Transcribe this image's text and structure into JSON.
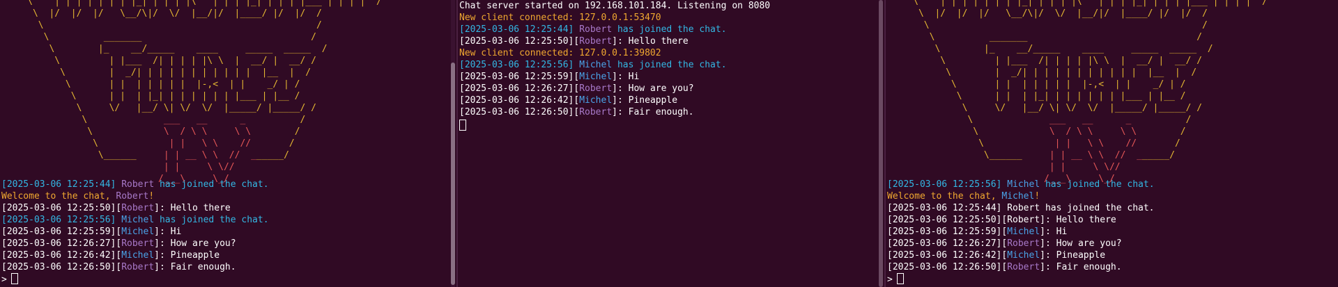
{
  "banner": {
    "lines": [
      "     \\    | | | | | | | |_| | | | |\\   | | | |_| | | | |___ | | | |  /",
      "      \\  |/  |/  |/   \\__/\\|/  \\/  |__/|/  |____/ |/  |/  /",
      "       \\                                                  /",
      "        \\          _______                               /",
      "         \\        |_    __/_____    ____     _____  _____  /",
      "          \\         | |___  /| | | | |\\ \\  |  __/ |  __/ /",
      "           \\        |  _/| | | | | | | | | | |  |__  |  /",
      "            \\       | |  | | | | |  |-,<  | |    _/ | /",
      "             \\      | |  | |_| | | | | | | |___ | |__ /",
      "              \\     \\/   |__/ \\| \\/  \\/  |_____/ |_____/ /",
      "               \\              ___   __      _          /",
      "                \\             \\  / \\ \\     \\ \\        /",
      "                 \\             | |   \\ \\    //       /",
      "                  \\______     | | __ \\ \\  //  ______/",
      "                              | |     \\ \\//",
      "                             /___\\     \\_/"
    ]
  },
  "left": {
    "lines": [
      [
        {
          "t": "[2025-03-06 12:25:44] ",
          "c": "cyan"
        },
        {
          "t": "Robert",
          "c": "purple"
        },
        {
          "t": " has joined the chat.",
          "c": "cyan"
        }
      ],
      [
        {
          "t": "Welcome to the chat, ",
          "c": "yellow"
        },
        {
          "t": "Robert",
          "c": "purple"
        },
        {
          "t": "!",
          "c": "yellow"
        }
      ],
      [
        {
          "t": "[2025-03-06 12:25:50][",
          "c": "white"
        },
        {
          "t": "Robert",
          "c": "purple"
        },
        {
          "t": "]: Hello there",
          "c": "white"
        }
      ],
      [
        {
          "t": "[2025-03-06 12:25:56] ",
          "c": "cyan"
        },
        {
          "t": "Michel",
          "c": "blue"
        },
        {
          "t": " has joined the chat.",
          "c": "cyan"
        }
      ],
      [
        {
          "t": "[2025-03-06 12:25:59][",
          "c": "white"
        },
        {
          "t": "Michel",
          "c": "blue"
        },
        {
          "t": "]: Hi",
          "c": "white"
        }
      ],
      [
        {
          "t": "[2025-03-06 12:26:27][",
          "c": "white"
        },
        {
          "t": "Robert",
          "c": "purple"
        },
        {
          "t": "]: How are you?",
          "c": "white"
        }
      ],
      [
        {
          "t": "[2025-03-06 12:26:42][",
          "c": "white"
        },
        {
          "t": "Michel",
          "c": "blue"
        },
        {
          "t": "]: Pineapple",
          "c": "white"
        }
      ],
      [
        {
          "t": "[2025-03-06 12:26:50][",
          "c": "white"
        },
        {
          "t": "Robert",
          "c": "purple"
        },
        {
          "t": "]: Fair enough.",
          "c": "white"
        }
      ]
    ],
    "prompt": ">"
  },
  "server": {
    "lines": [
      [
        {
          "t": "Chat server started on 192.168.101.184. Listening on 8080",
          "c": "white"
        }
      ],
      [
        {
          "t": "New client connected: 127.0.0.1:53470",
          "c": "yellow"
        }
      ],
      [
        {
          "t": "[2025-03-06 12:25:44] ",
          "c": "cyan"
        },
        {
          "t": "Robert",
          "c": "purple"
        },
        {
          "t": " has joined the chat.",
          "c": "cyan"
        }
      ],
      [
        {
          "t": "[2025-03-06 12:25:50][",
          "c": "white"
        },
        {
          "t": "Robert",
          "c": "purple"
        },
        {
          "t": "]: Hello there",
          "c": "white"
        }
      ],
      [
        {
          "t": "New client connected: 127.0.0.1:39802",
          "c": "yellow"
        }
      ],
      [
        {
          "t": "[2025-03-06 12:25:56] ",
          "c": "cyan"
        },
        {
          "t": "Michel",
          "c": "blue"
        },
        {
          "t": " has joined the chat.",
          "c": "cyan"
        }
      ],
      [
        {
          "t": "[2025-03-06 12:25:59][",
          "c": "white"
        },
        {
          "t": "Michel",
          "c": "blue"
        },
        {
          "t": "]: Hi",
          "c": "white"
        }
      ],
      [
        {
          "t": "[2025-03-06 12:26:27][",
          "c": "white"
        },
        {
          "t": "Robert",
          "c": "purple"
        },
        {
          "t": "]: How are you?",
          "c": "white"
        }
      ],
      [
        {
          "t": "[2025-03-06 12:26:42][",
          "c": "white"
        },
        {
          "t": "Michel",
          "c": "blue"
        },
        {
          "t": "]: Pineapple",
          "c": "white"
        }
      ],
      [
        {
          "t": "[2025-03-06 12:26:50][",
          "c": "white"
        },
        {
          "t": "Robert",
          "c": "purple"
        },
        {
          "t": "]: Fair enough.",
          "c": "white"
        }
      ]
    ]
  },
  "right": {
    "lines": [
      [
        {
          "t": "[2025-03-06 12:25:56] ",
          "c": "cyan"
        },
        {
          "t": "Michel",
          "c": "blue"
        },
        {
          "t": " has joined the chat.",
          "c": "cyan"
        }
      ],
      [
        {
          "t": "Welcome to the chat, ",
          "c": "yellow"
        },
        {
          "t": "Michel",
          "c": "blue"
        },
        {
          "t": "!",
          "c": "yellow"
        }
      ],
      [
        {
          "t": "[2025-03-06 12:25:44] Robert has joined the chat.",
          "c": "white"
        }
      ],
      [
        {
          "t": "[2025-03-06 12:25:50][Robert]: Hello there",
          "c": "white"
        }
      ],
      [
        {
          "t": "[2025-03-06 12:25:59][",
          "c": "white"
        },
        {
          "t": "Michel",
          "c": "blue"
        },
        {
          "t": "]: Hi",
          "c": "white"
        }
      ],
      [
        {
          "t": "[2025-03-06 12:26:27][",
          "c": "white"
        },
        {
          "t": "Robert",
          "c": "purple"
        },
        {
          "t": "]: How are you?",
          "c": "white"
        }
      ],
      [
        {
          "t": "[2025-03-06 12:26:42][",
          "c": "white"
        },
        {
          "t": "Michel",
          "c": "blue"
        },
        {
          "t": "]: Pineapple",
          "c": "white"
        }
      ],
      [
        {
          "t": "[2025-03-06 12:26:50][",
          "c": "white"
        },
        {
          "t": "Robert",
          "c": "purple"
        },
        {
          "t": "]: Fair enough.",
          "c": "white"
        }
      ]
    ],
    "prompt": ">"
  },
  "colors": {
    "background": "#300a24",
    "cyan": "#33b7e4",
    "yellow": "#f0a830",
    "purple": "#a879c9",
    "blue": "#4aa3e8",
    "banner_frame": "#e5b832",
    "banner_logo": "#e55757"
  }
}
